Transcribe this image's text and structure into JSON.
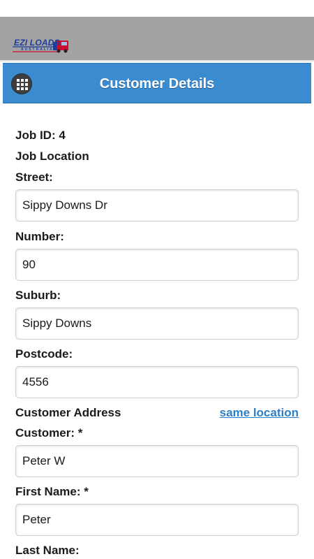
{
  "brand": {
    "logo_text": "EZI LOADS",
    "logo_subtext": "AUSTRALIA"
  },
  "header": {
    "title": "Customer Details",
    "menu_icon": "grid-icon"
  },
  "job": {
    "id_label": "Job ID: 4",
    "location_heading": "Job Location"
  },
  "fields": {
    "street": {
      "label": "Street:",
      "value": "Sippy Downs Dr"
    },
    "number": {
      "label": "Number:",
      "value": "90"
    },
    "suburb": {
      "label": "Suburb:",
      "value": "Sippy Downs"
    },
    "postcode": {
      "label": "Postcode:",
      "value": "4556"
    },
    "customer": {
      "label": "Customer: *",
      "value": "Peter W"
    },
    "first_name": {
      "label": "First Name: *",
      "value": "Peter"
    },
    "last_name": {
      "label": "Last Name:"
    }
  },
  "customer_address": {
    "heading": "Customer Address",
    "same_location_link": "same location"
  },
  "colors": {
    "header_blue": "#3a8bcf",
    "link_blue": "#2f7fc4",
    "brand_bar_gray": "#a3a3a3"
  }
}
